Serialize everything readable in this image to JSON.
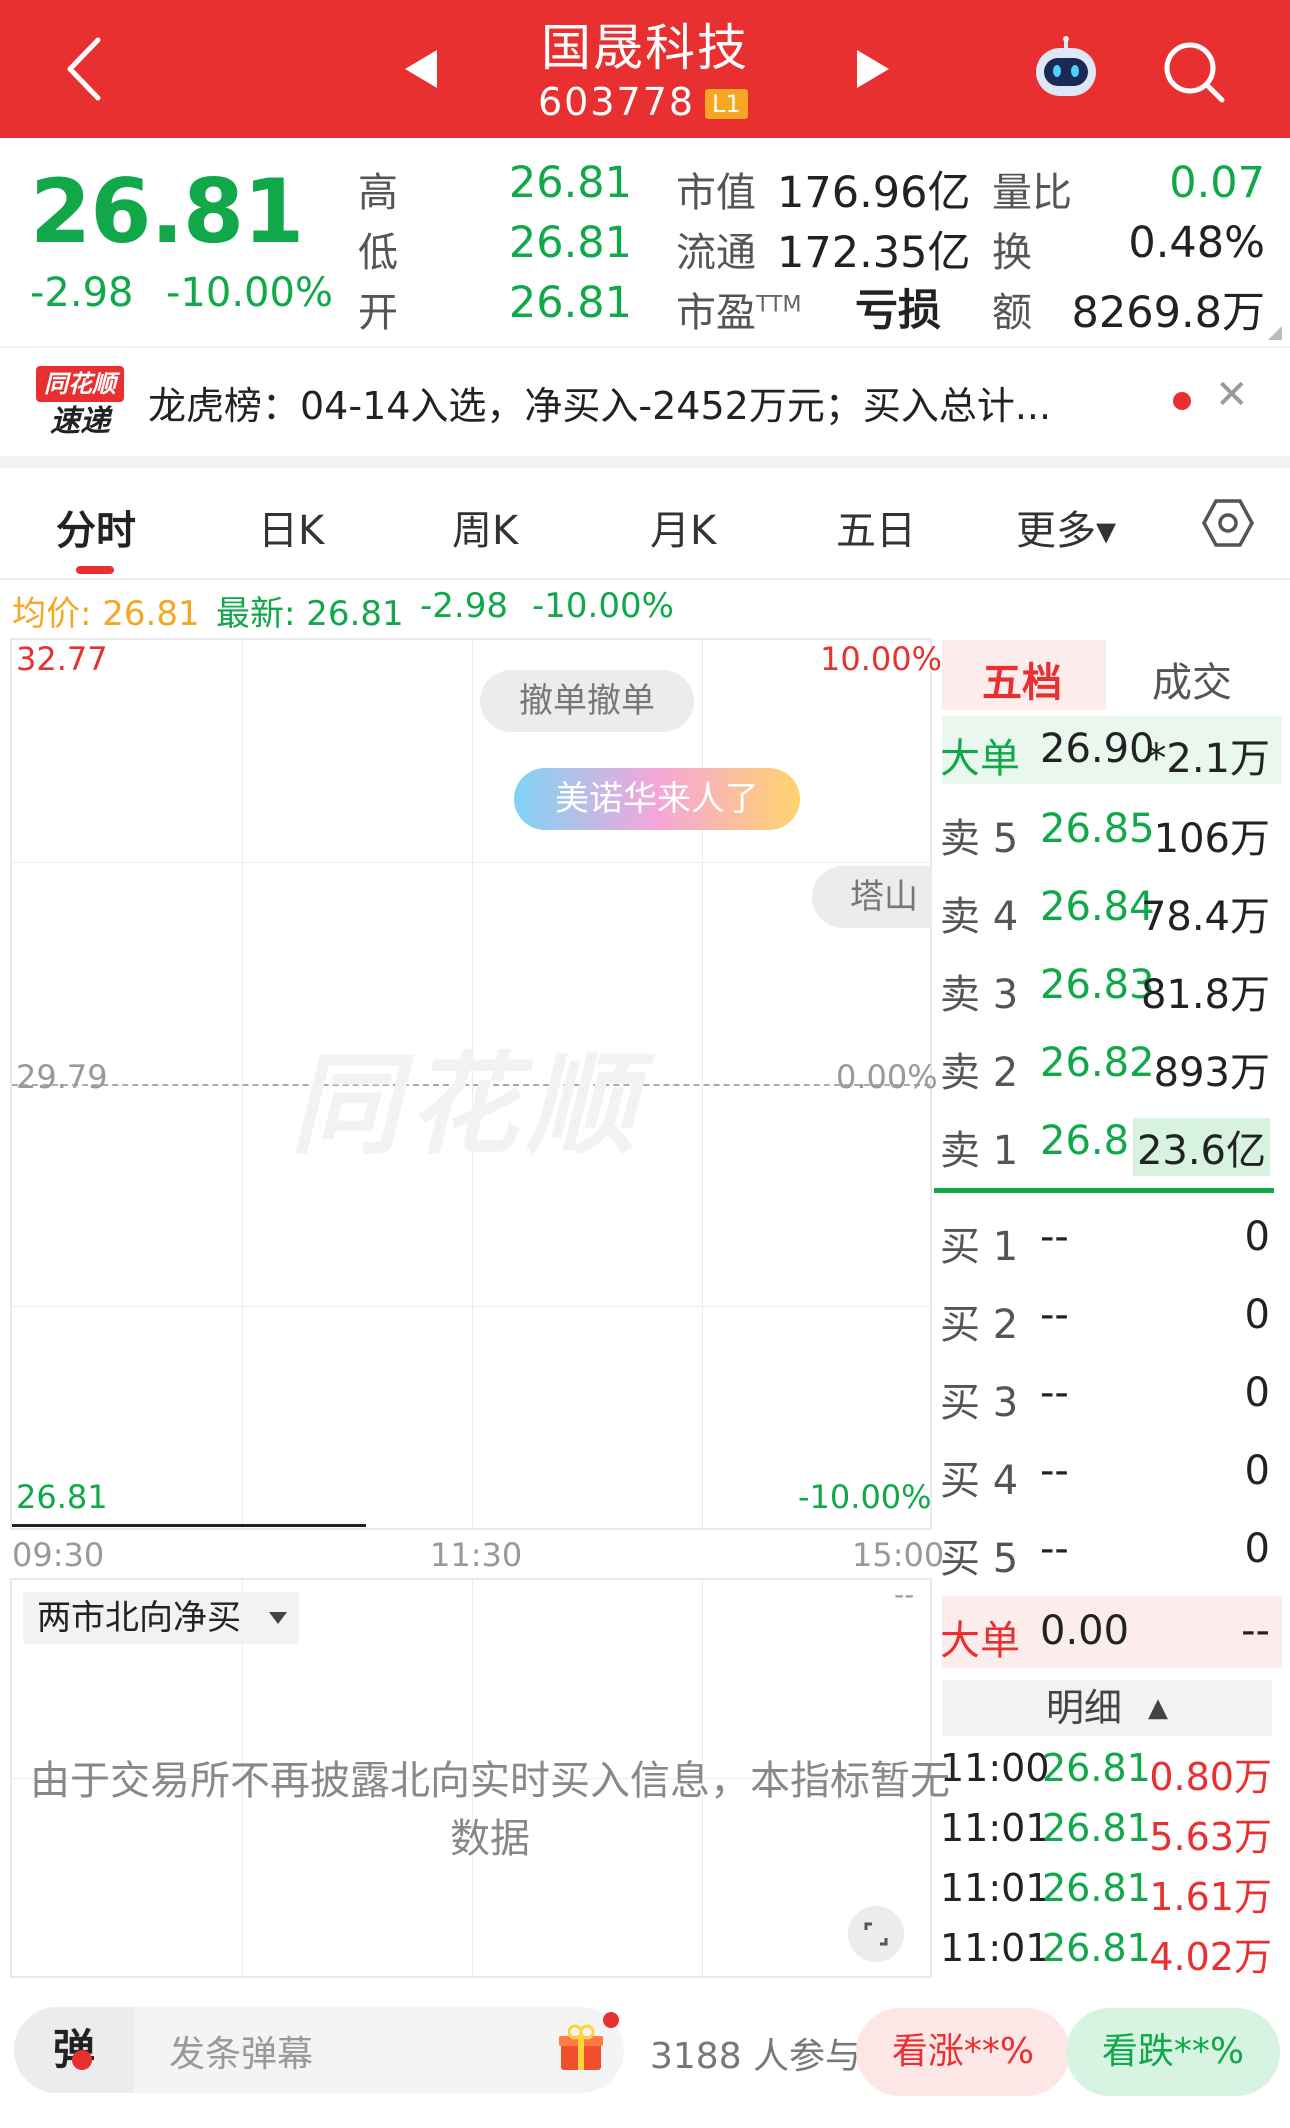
{
  "header": {
    "stock_name": "国晟科技",
    "stock_code": "603778",
    "level_badge": "L1"
  },
  "quote": {
    "price": "26.81",
    "change": "-2.98",
    "change_pct": "-10.00%",
    "high_label": "高",
    "high": "26.81",
    "low_label": "低",
    "low": "26.81",
    "open_label": "开",
    "open": "26.81",
    "mktcap_label": "市值",
    "mktcap": "176.96亿",
    "float_label": "流通",
    "float": "172.35亿",
    "pe_label": "市盈",
    "pe_sup": "TTM",
    "pe": "亏损",
    "vr_label": "量比",
    "vr": "0.07",
    "turnover_label": "换",
    "turnover": "0.48%",
    "amount_label": "额",
    "amount": "8269.8万"
  },
  "news": {
    "logo_top": "同花顺",
    "logo_bottom": "速递",
    "text": "龙虎榜：04-14入选，净买入-2452万元；买入总计..."
  },
  "tabs": [
    "分时",
    "日K",
    "周K",
    "月K",
    "五日",
    "更多▾"
  ],
  "stats": {
    "avg": "均价: 26.81",
    "latest": "最新: 26.81",
    "change": "-2.98",
    "change_pct": "-10.00%"
  },
  "chart": {
    "y_top": "32.77",
    "y_mid": "29.79",
    "y_bottom": "26.81",
    "pct_top": "10.00%",
    "pct_mid": "0.00%",
    "pct_bottom": "-10.00%",
    "x_start": "09:30",
    "x_mid": "11:30",
    "x_end": "15:00",
    "watermark": "同花顺",
    "bubble1": "撤单撤单",
    "bubble2": "美诺华来人了",
    "bubble3": "塔山"
  },
  "order_book": {
    "tab_active": "五档",
    "tab_other": "成交",
    "big_sell": {
      "label": "大单",
      "price": "26.90",
      "vol": "*2.1万"
    },
    "sells": [
      {
        "label": "卖 5",
        "price": "26.85",
        "vol": "106万"
      },
      {
        "label": "卖 4",
        "price": "26.84",
        "vol": "78.4万"
      },
      {
        "label": "卖 3",
        "price": "26.83",
        "vol": "81.8万"
      },
      {
        "label": "卖 2",
        "price": "26.82",
        "vol": "893万"
      },
      {
        "label": "卖 1",
        "price": "26.81",
        "vol": "23.6亿"
      }
    ],
    "buys": [
      {
        "label": "买 1",
        "price": "--",
        "vol": "0"
      },
      {
        "label": "买 2",
        "price": "--",
        "vol": "0"
      },
      {
        "label": "买 3",
        "price": "--",
        "vol": "0"
      },
      {
        "label": "买 4",
        "price": "--",
        "vol": "0"
      },
      {
        "label": "买 5",
        "price": "--",
        "vol": "0"
      }
    ],
    "big_buy": {
      "label": "大单",
      "price": "0.00",
      "vol": "--"
    }
  },
  "indicator": {
    "selector": "两市北向净买",
    "dash": "--",
    "message": "由于交易所不再披露北向实时买入信息，本指标暂无数据"
  },
  "detail": {
    "label": "明细",
    "trades": [
      {
        "time": "11:00",
        "price": "26.81",
        "vol": "0.80万"
      },
      {
        "time": "11:01",
        "price": "26.81",
        "vol": "5.63万"
      },
      {
        "time": "11:01",
        "price": "26.81",
        "vol": "1.61万"
      },
      {
        "time": "11:01",
        "price": "26.81",
        "vol": "4.02万"
      }
    ]
  },
  "bottom": {
    "dan": "弹",
    "placeholder": "发条弹幕",
    "participants": "3188 人参与",
    "rise": "看涨**%",
    "fall": "看跌**%"
  },
  "colors": {
    "brand": "#e93030",
    "up": "#e93030",
    "down": "#11a84a",
    "avg_line": "#f5a623"
  }
}
